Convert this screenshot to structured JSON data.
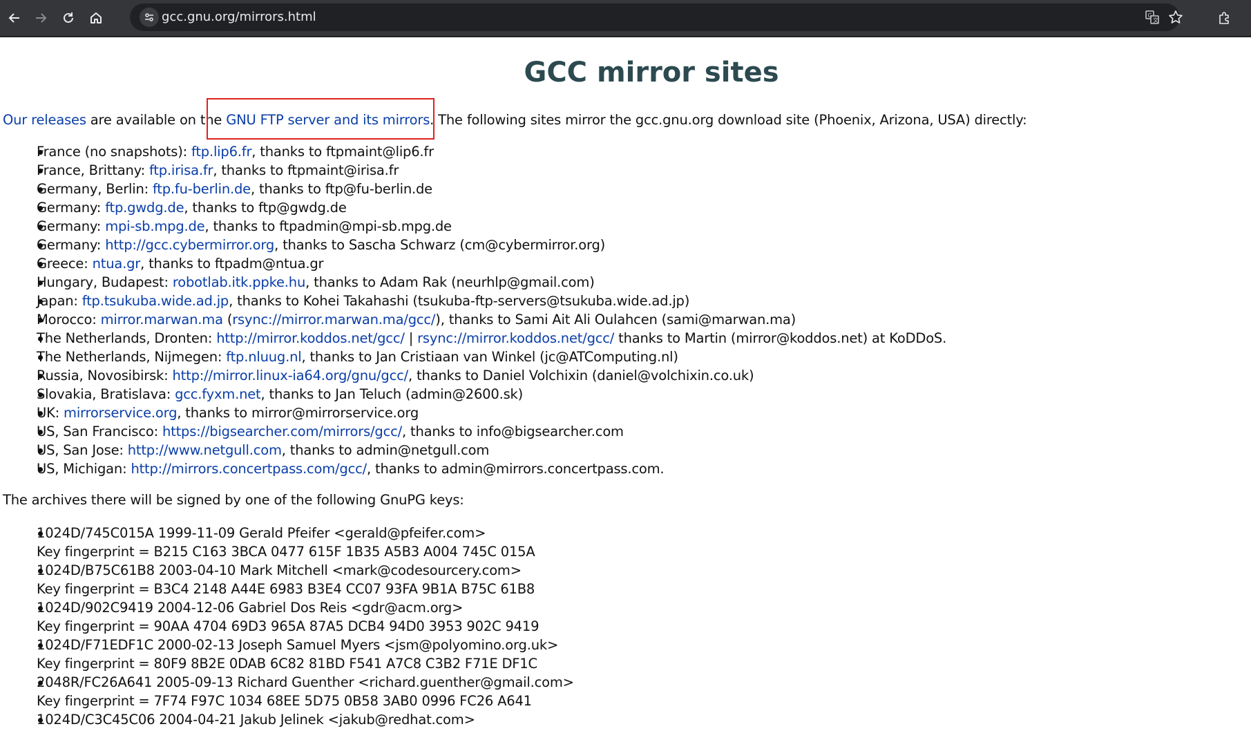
{
  "browser": {
    "url": "gcc.gnu.org/mirrors.html",
    "icons": [
      "back-icon",
      "forward-icon",
      "reload-icon",
      "home-icon",
      "site-info-icon",
      "translate-icon",
      "bookmark-star-icon",
      "extensions-icon"
    ]
  },
  "page": {
    "title": "GCC mirror sites",
    "intro": {
      "releases_link": "Our releases",
      "text1": " are available on the ",
      "ftp_link": "GNU FTP server and its mirrors",
      "text2": ". The following sites mirror the gcc.gnu.org download site (Phoenix, Arizona, USA) directly:"
    },
    "mirrors": [
      {
        "prefix": "France (no snapshots): ",
        "link": "ftp.lip6.fr",
        "suffix": ", thanks to ftpmaint@lip6.fr"
      },
      {
        "prefix": "France, Brittany: ",
        "link": "ftp.irisa.fr",
        "suffix": ", thanks to ftpmaint@irisa.fr"
      },
      {
        "prefix": "Germany, Berlin: ",
        "link": "ftp.fu-berlin.de",
        "suffix": ", thanks to ftp@fu-berlin.de"
      },
      {
        "prefix": "Germany: ",
        "link": "ftp.gwdg.de",
        "suffix": ", thanks to ftp@gwdg.de"
      },
      {
        "prefix": "Germany: ",
        "link": "mpi-sb.mpg.de",
        "suffix": ", thanks to ftpadmin@mpi-sb.mpg.de"
      },
      {
        "prefix": "Germany: ",
        "link": "http://gcc.cybermirror.org",
        "suffix": ", thanks to Sascha Schwarz (cm@cybermirror.org)"
      },
      {
        "prefix": "Greece: ",
        "link": "ntua.gr",
        "suffix": ", thanks to ftpadm@ntua.gr"
      },
      {
        "prefix": "Hungary, Budapest: ",
        "link": "robotlab.itk.ppke.hu",
        "suffix": ", thanks to Adam Rak (neurhlp@gmail.com)"
      },
      {
        "prefix": "Japan: ",
        "link": "ftp.tsukuba.wide.ad.jp",
        "suffix": ", thanks to Kohei Takahashi (tsukuba-ftp-servers@tsukuba.wide.ad.jp)"
      },
      {
        "prefix": "Morocco: ",
        "link": "mirror.marwan.ma",
        "mid": " (",
        "link2": "rsync://mirror.marwan.ma/gcc/",
        "suffix": "), thanks to Sami Ait Ali Oulahcen (sami@marwan.ma)"
      },
      {
        "prefix": "The Netherlands, Dronten:  ",
        "link": "http://mirror.koddos.net/gcc/",
        "mid": "  |   ",
        "link2": "rsync://mirror.koddos.net/gcc/",
        "suffix": "   thanks to Martin (mirror@koddos.net) at KoDDoS."
      },
      {
        "prefix": "The Netherlands, Nijmegen: ",
        "link": "ftp.nluug.nl",
        "suffix": ", thanks to Jan Cristiaan van Winkel (jc@ATComputing.nl)"
      },
      {
        "prefix": "Russia, Novosibirsk: ",
        "link": "http://mirror.linux-ia64.org/gnu/gcc/",
        "suffix": ", thanks to Daniel Volchixin (daniel@volchixin.co.uk)"
      },
      {
        "prefix": "Slovakia, Bratislava: ",
        "link": "gcc.fyxm.net",
        "suffix": ", thanks to Jan Teluch (admin@2600.sk)"
      },
      {
        "prefix": "UK: ",
        "link": "mirrorservice.org",
        "suffix": ", thanks to mirror@mirrorservice.org"
      },
      {
        "prefix": "US, San Francisco: ",
        "link": "https://bigsearcher.com/mirrors/gcc/",
        "suffix": ", thanks to info@bigsearcher.com"
      },
      {
        "prefix": "US, San Jose: ",
        "link": "http://www.netgull.com",
        "suffix": ", thanks to admin@netgull.com"
      },
      {
        "prefix": "US, Michigan: ",
        "link": "http://mirrors.concertpass.com/gcc/",
        "suffix": ", thanks to admin@mirrors.concertpass.com."
      }
    ],
    "archives_text": "The archives there will be signed by one of the following GnuPG keys:",
    "keys": [
      {
        "id": "1024D/745C015A 1999-11-09 Gerald Pfeifer <gerald@pfeifer.com>",
        "fingerprint": "Key fingerprint = B215 C163 3BCA 0477 615F 1B35 A5B3 A004 745C 015A"
      },
      {
        "id": "1024D/B75C61B8 2003-04-10 Mark Mitchell <mark@codesourcery.com>",
        "fingerprint": "Key fingerprint = B3C4 2148 A44E 6983 B3E4 CC07 93FA 9B1A B75C 61B8"
      },
      {
        "id": "1024D/902C9419 2004-12-06 Gabriel Dos Reis <gdr@acm.org>",
        "fingerprint": "Key fingerprint = 90AA 4704 69D3 965A 87A5 DCB4 94D0 3953 902C 9419"
      },
      {
        "id": "1024D/F71EDF1C 2000-02-13 Joseph Samuel Myers <jsm@polyomino.org.uk>",
        "fingerprint": "Key fingerprint = 80F9 8B2E 0DAB 6C82 81BD F541 A7C8 C3B2 F71E DF1C"
      },
      {
        "id": "2048R/FC26A641 2005-09-13 Richard Guenther <richard.guenther@gmail.com>",
        "fingerprint": "Key fingerprint = 7F74 F97C 1034 68EE 5D75 0B58 3AB0 0996 FC26 A641"
      },
      {
        "id": "1024D/C3C45C06 2004-04-21 Jakub Jelinek <jakub@redhat.com>"
      }
    ]
  }
}
